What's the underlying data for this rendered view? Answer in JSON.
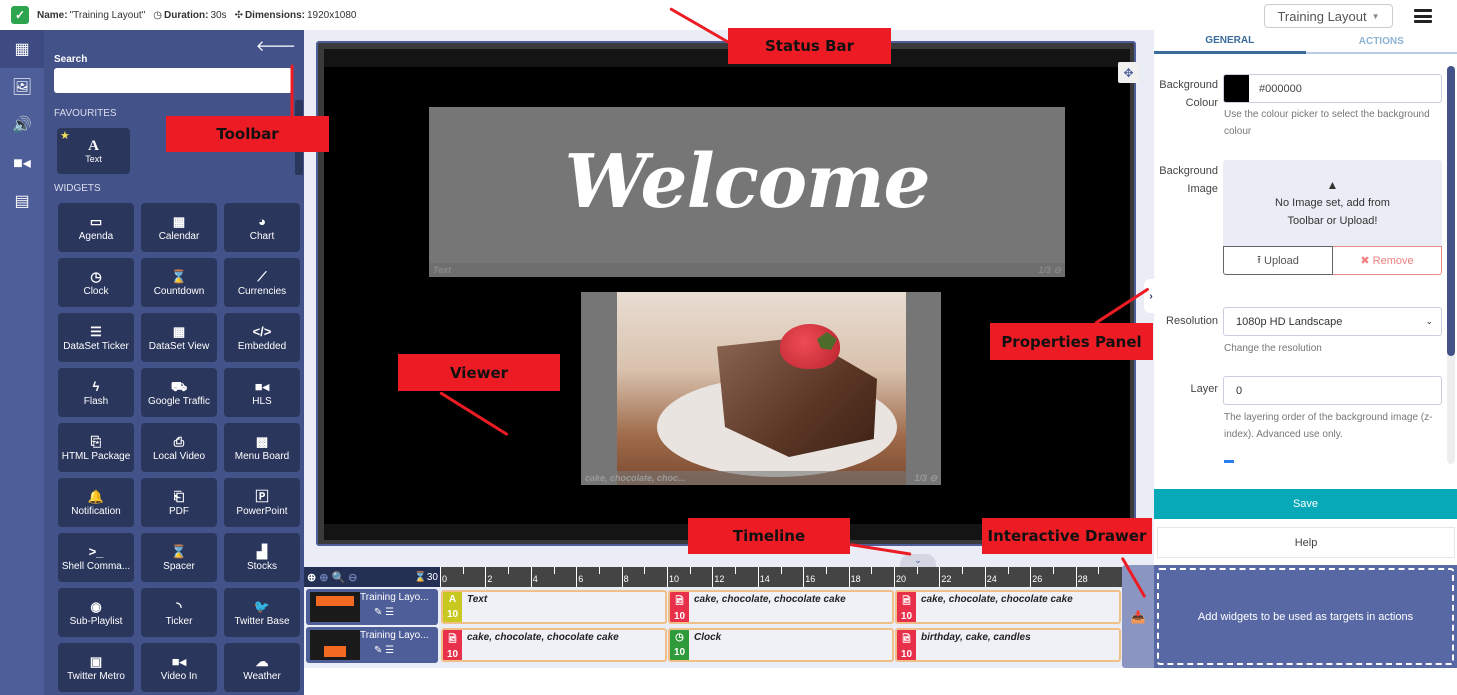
{
  "status_bar": {
    "name_label": "Name:",
    "name_value": "\"Training Layout\"",
    "duration_label": "Duration:",
    "duration_value": "30s",
    "dimensions_label": "Dimensions:",
    "dimensions_value": "1920x1080"
  },
  "header": {
    "layout_select_value": "Training Layout",
    "menu_icon": "hamburger-icon"
  },
  "rail": {
    "items": [
      {
        "name": "widgets",
        "icon": "grid-icon",
        "active": true
      },
      {
        "name": "images",
        "icon": "image-icon"
      },
      {
        "name": "audio",
        "icon": "volume-icon"
      },
      {
        "name": "video",
        "icon": "video-icon"
      },
      {
        "name": "library",
        "icon": "archive-icon"
      }
    ]
  },
  "toolbar": {
    "search_label": "Search",
    "search_value": "",
    "favourites_label": "FAVOURITES",
    "favourites": [
      {
        "label": "Text",
        "icon": "text-icon",
        "glyph": "A"
      }
    ],
    "widgets_label": "WIDGETS",
    "widgets": [
      {
        "label": "Agenda",
        "icon": "calendar-blank-icon",
        "glyph": "▭"
      },
      {
        "label": "Calendar",
        "icon": "calendar-icon",
        "glyph": "▦"
      },
      {
        "label": "Chart",
        "icon": "pie-chart-icon",
        "glyph": "◕"
      },
      {
        "label": "Clock",
        "icon": "clock-icon",
        "glyph": "◷"
      },
      {
        "label": "Countdown",
        "icon": "hourglass-icon",
        "glyph": "⌛"
      },
      {
        "label": "Currencies",
        "icon": "line-chart-icon",
        "glyph": "⟋"
      },
      {
        "label": "DataSet Ticker",
        "icon": "list-icon",
        "glyph": "☰"
      },
      {
        "label": "DataSet View",
        "icon": "table-icon",
        "glyph": "▦"
      },
      {
        "label": "Embedded",
        "icon": "code-icon",
        "glyph": "</>"
      },
      {
        "label": "Flash",
        "icon": "bolt-icon",
        "glyph": "ϟ"
      },
      {
        "label": "Google Traffic",
        "icon": "car-icon",
        "glyph": "⛟"
      },
      {
        "label": "HLS",
        "icon": "video-camera-icon",
        "glyph": "■◂"
      },
      {
        "label": "HTML Package",
        "icon": "file-code-icon",
        "glyph": "⎘"
      },
      {
        "label": "Local Video",
        "icon": "file-video-icon",
        "glyph": "⎙"
      },
      {
        "label": "Menu Board",
        "icon": "th-icon",
        "glyph": "▩"
      },
      {
        "label": "Notification",
        "icon": "bell-icon",
        "glyph": "🔔"
      },
      {
        "label": "PDF",
        "icon": "file-pdf-icon",
        "glyph": "⎗"
      },
      {
        "label": "PowerPoint",
        "icon": "file-powerpoint-icon",
        "glyph": "🄿"
      },
      {
        "label": "Shell Comma...",
        "icon": "terminal-icon",
        "glyph": ">_"
      },
      {
        "label": "Spacer",
        "icon": "hourglass-icon",
        "glyph": "⌛"
      },
      {
        "label": "Stocks",
        "icon": "bar-chart-icon",
        "glyph": "▟"
      },
      {
        "label": "Sub-Playlist",
        "icon": "play-circle-icon",
        "glyph": "◉"
      },
      {
        "label": "Ticker",
        "icon": "rss-icon",
        "glyph": "◝"
      },
      {
        "label": "Twitter Base",
        "icon": "twitter-icon",
        "glyph": "🐦"
      },
      {
        "label": "Twitter Metro",
        "icon": "twitter-square-icon",
        "glyph": "▣"
      },
      {
        "label": "Video In",
        "icon": "video-camera-icon",
        "glyph": "■◂"
      },
      {
        "label": "Weather",
        "icon": "cloud-icon",
        "glyph": "☁"
      }
    ]
  },
  "viewer": {
    "text_region": {
      "content": "Welcome",
      "label": "Text",
      "page": "1/3"
    },
    "image_region": {
      "label": "cake, chocolate, choc...",
      "page": "1/3"
    }
  },
  "timeline": {
    "duration": "30",
    "ruler_labels": [
      "0",
      "2",
      "4",
      "6",
      "8",
      "10",
      "12",
      "14",
      "16",
      "18",
      "20",
      "22",
      "24",
      "26",
      "28"
    ],
    "rows": [
      {
        "name": "Training Layo...",
        "widgets": [
          {
            "type": "text",
            "tag_glyph": "A",
            "duration": "10",
            "name": "Text",
            "color": "#c8c820",
            "start": 0,
            "length": 10
          },
          {
            "type": "image",
            "tag_glyph": "🖻",
            "duration": "10",
            "name": "cake, chocolate, chocolate cake",
            "color": "#e8304a",
            "start": 10,
            "length": 10
          },
          {
            "type": "image",
            "tag_glyph": "🖻",
            "duration": "10",
            "name": "cake, chocolate, chocolate cake",
            "color": "#e8304a",
            "start": 20,
            "length": 10
          }
        ]
      },
      {
        "name": "Training Layo...",
        "widgets": [
          {
            "type": "image",
            "tag_glyph": "🖻",
            "duration": "10",
            "name": "cake, chocolate, chocolate cake",
            "color": "#e8304a",
            "start": 0,
            "length": 10
          },
          {
            "type": "clock",
            "tag_glyph": "◷",
            "duration": "10",
            "name": "Clock",
            "color": "#2e9a3a",
            "start": 10,
            "length": 10
          },
          {
            "type": "image",
            "tag_glyph": "🖻",
            "duration": "10",
            "name": "birthday, cake, candles",
            "color": "#e8304a",
            "start": 20,
            "length": 10
          }
        ]
      }
    ]
  },
  "drawer": {
    "message": "Add widgets to be used as targets in actions"
  },
  "properties": {
    "tabs": [
      {
        "label": "GENERAL",
        "active": true
      },
      {
        "label": "ACTIONS",
        "active": false
      }
    ],
    "background_colour_label": "Background Colour",
    "background_colour_value": "#000000",
    "background_colour_help": "Use the colour picker to select the background colour",
    "background_image_label": "Background Image",
    "no_image_line1": "No Image set, add from",
    "no_image_line2": "Toolbar or Upload!",
    "upload_label": "Upload",
    "remove_label": "Remove",
    "resolution_label": "Resolution",
    "resolution_value": "1080p HD Landscape",
    "resolution_help": "Change the resolution",
    "layer_label": "Layer",
    "layer_value": "0",
    "layer_help": "The layering order of the background image (z-index). Advanced use only.",
    "save_label": "Save",
    "help_label": "Help"
  },
  "annotations": [
    {
      "label": "Status Bar"
    },
    {
      "label": "Toolbar"
    },
    {
      "label": "Viewer"
    },
    {
      "label": "Properties Panel"
    },
    {
      "label": "Timeline"
    },
    {
      "label": "Interactive Drawer"
    }
  ]
}
